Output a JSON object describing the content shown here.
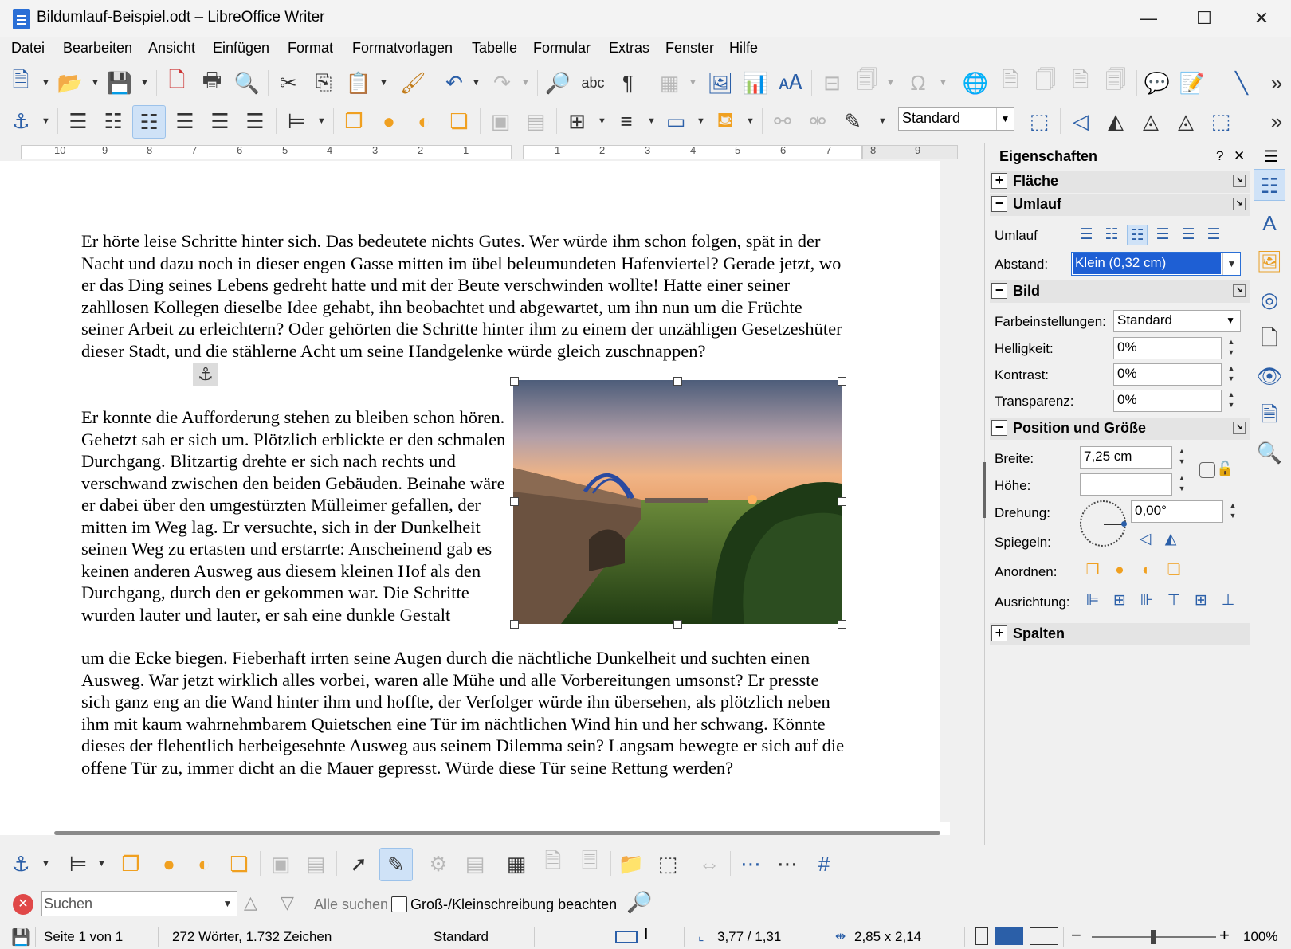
{
  "window": {
    "title": "Bildumlauf-Beispiel.odt – LibreOffice Writer",
    "minimize": "—",
    "maximize": "☐",
    "close": "✕"
  },
  "menu": [
    "Datei",
    "Bearbeiten",
    "Ansicht",
    "Einfügen",
    "Format",
    "Formatvorlagen",
    "Tabelle",
    "Formular",
    "Extras",
    "Fenster",
    "Hilfe"
  ],
  "toolbar": {
    "frame_style": "Standard",
    "overflow": "»"
  },
  "ruler": {
    "left_ticks": [
      "10",
      "9",
      "8",
      "7",
      "6",
      "5",
      "4",
      "3",
      "2",
      "1"
    ],
    "right_ticks": [
      "1",
      "2",
      "3",
      "4",
      "5",
      "6",
      "7",
      "8",
      "9"
    ]
  },
  "document": {
    "p1": "Er hörte leise Schritte hinter sich. Das bedeutete nichts Gutes. Wer würde ihm schon folgen, spät in der Nacht und dazu noch in dieser engen Gasse mitten im übel beleumundeten Hafenviertel? Gerade jetzt, wo er das Ding seines Lebens gedreht hatte und mit der Beute verschwinden wollte! Hatte einer seiner zahllosen Kollegen dieselbe Idee gehabt, ihn beobachtet und abgewartet, um ihn nun um die Früchte seiner Arbeit zu erleichtern? Oder gehörten die Schritte hinter ihm zu einem der unzähligen Gesetzeshüter dieser Stadt, und die stählerne Acht um seine Handgelenke würde gleich zuschnappen?",
    "p2": "Er konnte die Aufforderung stehen zu bleiben schon hören. Gehetzt sah er sich um. Plötzlich erblickte er den schmalen Durchgang. Blitzartig drehte er sich nach rechts und verschwand zwischen den beiden Gebäuden. Beinahe wäre er dabei über den umgestürzten Mülleimer gefallen, der mitten im Weg lag. Er versuchte, sich in der Dunkelheit seinen Weg zu ertasten und erstarrte: Anscheinend gab es keinen anderen Ausweg aus diesem kleinen Hof als den Durchgang, durch den er gekommen war. Die Schritte wurden lauter und lauter, er sah eine dunkle Gestalt",
    "p3": "um die Ecke biegen. Fieberhaft irrten seine Augen durch die nächtliche Dunkelheit und suchten einen Ausweg. War jetzt wirklich alles vorbei, waren alle Mühe und alle Vorbereitungen umsonst? Er presste sich ganz eng an die Wand hinter ihm und hoffte, der Verfolger würde ihn übersehen, als plötzlich neben ihm mit kaum wahrnehmbarem Quietschen eine Tür im nächtlichen Wind hin und her schwang. Könnte dieses der flehentlich herbeigesehnte Ausweg aus seinem Dilemma sein? Langsam bewegte er sich auf die offene Tür zu, immer dicht an die Mauer gepresst. Würde diese Tür seine Rettung werden?"
  },
  "sidebar": {
    "title": "Eigenschaften",
    "help": "?",
    "close": "✕",
    "menu": "☰",
    "sections": {
      "flaeche": "Fläche",
      "umlauf": "Umlauf",
      "bild": "Bild",
      "position": "Position und Größe",
      "spalten": "Spalten"
    },
    "umlauf_label": "Umlauf",
    "abstand_label": "Abstand:",
    "abstand_value": "Klein (0,32 cm)",
    "farbe_label": "Farbeinstellungen:",
    "farbe_value": "Standard",
    "helligkeit_label": "Helligkeit:",
    "helligkeit_value": "0%",
    "kontrast_label": "Kontrast:",
    "kontrast_value": "0%",
    "transparenz_label": "Transparenz:",
    "transparenz_value": "0%",
    "breite_label": "Breite:",
    "breite_value": "7,25 cm",
    "hoehe_label": "Höhe:",
    "hoehe_value": "",
    "drehung_label": "Drehung:",
    "drehung_value": "0,00°",
    "spiegeln_label": "Spiegeln:",
    "anordnen_label": "Anordnen:",
    "ausrichtung_label": "Ausrichtung:"
  },
  "find": {
    "placeholder": "Suchen",
    "find_all": "Alle suchen",
    "match_case": "Groß-/Kleinschreibung beachten"
  },
  "status": {
    "page": "Seite 1 von 1",
    "words": "272 Wörter, 1.732 Zeichen",
    "style": "Standard",
    "position": "3,77 / 1,31",
    "size": "2,85 x 2,14",
    "zoom": "100%"
  },
  "colors": {
    "accent": "#2b5fa8",
    "selection": "#1e5fd4"
  }
}
